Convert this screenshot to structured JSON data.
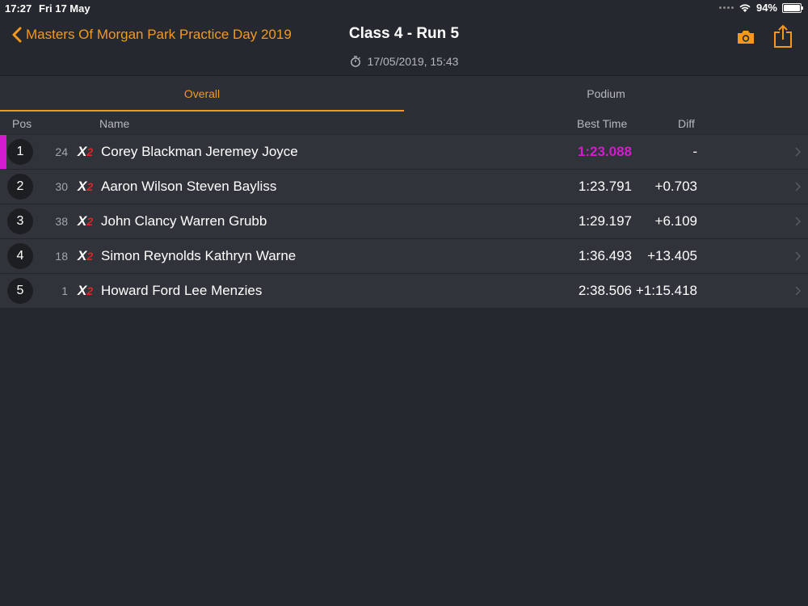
{
  "status_bar": {
    "time": "17:27",
    "date": "Fri 17 May",
    "battery": "94%",
    "icons": [
      "signal-dots-icon",
      "wifi-icon",
      "battery-icon"
    ]
  },
  "nav": {
    "back_label": "Masters Of Morgan Park Practice Day 2019",
    "title": "Class 4 - Run 5",
    "subtitle": "17/05/2019, 15:43",
    "icons": [
      "chevron-left-icon",
      "stopwatch-icon",
      "camera-icon",
      "share-icon"
    ]
  },
  "tabs": [
    {
      "label": "Overall",
      "active": true
    },
    {
      "label": "Podium",
      "active": false
    }
  ],
  "columns": {
    "pos": "Pos",
    "name": "Name",
    "best_time": "Best Time",
    "diff": "Diff"
  },
  "results": [
    {
      "pos": "1",
      "number": "24",
      "class_badge": {
        "x": "X",
        "n": "2"
      },
      "name": "Corey Blackman Jeremey Joyce",
      "best_time": "1:23.088",
      "diff": "-",
      "fastest": true
    },
    {
      "pos": "2",
      "number": "30",
      "class_badge": {
        "x": "X",
        "n": "2"
      },
      "name": "Aaron Wilson Steven Bayliss",
      "best_time": "1:23.791",
      "diff": "+0.703",
      "fastest": false
    },
    {
      "pos": "3",
      "number": "38",
      "class_badge": {
        "x": "X",
        "n": "2"
      },
      "name": "John Clancy Warren Grubb",
      "best_time": "1:29.197",
      "diff": "+6.109",
      "fastest": false
    },
    {
      "pos": "4",
      "number": "18",
      "class_badge": {
        "x": "X",
        "n": "2"
      },
      "name": "Simon Reynolds Kathryn Warne",
      "best_time": "1:36.493",
      "diff": "+13.405",
      "fastest": false
    },
    {
      "pos": "5",
      "number": "1",
      "class_badge": {
        "x": "X",
        "n": "2"
      },
      "name": "Howard Ford Lee Menzies",
      "best_time": "2:38.506",
      "diff": "+1:15.418",
      "fastest": false
    }
  ],
  "colors": {
    "accent": "#f39a1e",
    "fastest": "#d41bd0",
    "background": "#25282e",
    "row": "#30333a"
  }
}
